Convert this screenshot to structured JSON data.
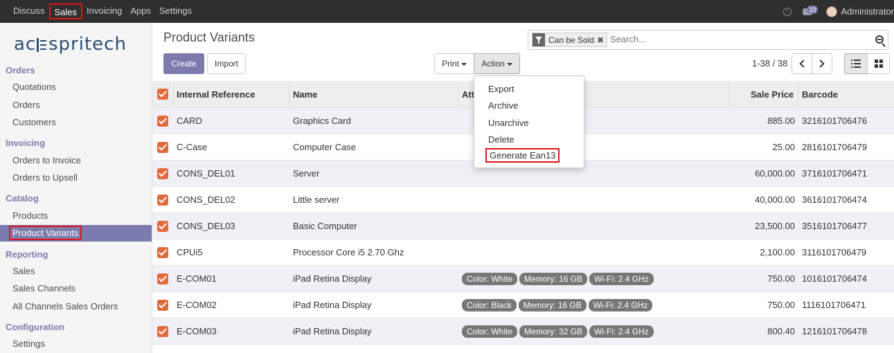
{
  "topbar": {
    "nav": [
      "Discuss",
      "Sales",
      "Invoicing",
      "Apps",
      "Settings"
    ],
    "active": "Sales",
    "chat_count": "10",
    "user": "Administrator"
  },
  "logo": "acespritech",
  "sidebar": {
    "sections": [
      {
        "title": "Orders",
        "items": [
          "Quotations",
          "Orders",
          "Customers"
        ]
      },
      {
        "title": "Invoicing",
        "items": [
          "Orders to Invoice",
          "Orders to Upsell"
        ]
      },
      {
        "title": "Catalog",
        "items": [
          "Products",
          "Product Variants"
        ]
      },
      {
        "title": "Reporting",
        "items": [
          "Sales",
          "Sales Channels",
          "All Channels Sales Orders"
        ]
      },
      {
        "title": "Configuration",
        "items": [
          "Settings"
        ]
      }
    ],
    "active_item": "Product Variants"
  },
  "page": {
    "title": "Product Variants",
    "create": "Create",
    "import": "Import",
    "print": "Print",
    "action": "Action",
    "pager": "1-38 / 38"
  },
  "search": {
    "facet": "Can be Sold",
    "placeholder": "Search..."
  },
  "action_menu": [
    "Export",
    "Archive",
    "Unarchive",
    "Delete",
    "Generate Ean13"
  ],
  "table": {
    "headers": {
      "ref": "Internal Reference",
      "name": "Name",
      "attr": "Att",
      "price": "Sale Price",
      "barcode": "Barcode"
    },
    "rows": [
      {
        "ref": "CARD",
        "name": "Graphics Card",
        "attrs": [],
        "price": "885.00",
        "barcode": "3216101706476"
      },
      {
        "ref": "C-Case",
        "name": "Computer Case",
        "attrs": [],
        "price": "25.00",
        "barcode": "2816101706479"
      },
      {
        "ref": "CONS_DEL01",
        "name": "Server",
        "attrs": [],
        "price": "60,000.00",
        "barcode": "3716101706471"
      },
      {
        "ref": "CONS_DEL02",
        "name": "Little server",
        "attrs": [],
        "price": "40,000.00",
        "barcode": "3616101706474"
      },
      {
        "ref": "CONS_DEL03",
        "name": "Basic Computer",
        "attrs": [],
        "price": "23,500.00",
        "barcode": "3516101706477"
      },
      {
        "ref": "CPUi5",
        "name": "Processor Core i5 2.70 Ghz",
        "attrs": [],
        "price": "2,100.00",
        "barcode": "3116101706479"
      },
      {
        "ref": "E-COM01",
        "name": "iPad Retina Display",
        "attrs": [
          "Color: White",
          "Memory: 16 GB",
          "Wi-Fi: 2.4 GHz"
        ],
        "price": "750.00",
        "barcode": "1016101706474"
      },
      {
        "ref": "E-COM02",
        "name": "iPad Retina Display",
        "attrs": [
          "Color: Black",
          "Memory: 16 GB",
          "Wi-Fi: 2.4 GHz"
        ],
        "price": "750.00",
        "barcode": "1116101706471"
      },
      {
        "ref": "E-COM03",
        "name": "iPad Retina Display",
        "attrs": [
          "Color: White",
          "Memory: 32 GB",
          "Wi-Fi: 2.4 GHz"
        ],
        "price": "800.40",
        "barcode": "1216101706478"
      }
    ]
  },
  "colors": {
    "brand": "#7c7bad",
    "topbar": "#2f2f2f",
    "checkbox": "#e36a3c",
    "highlight": "#e1141c"
  }
}
